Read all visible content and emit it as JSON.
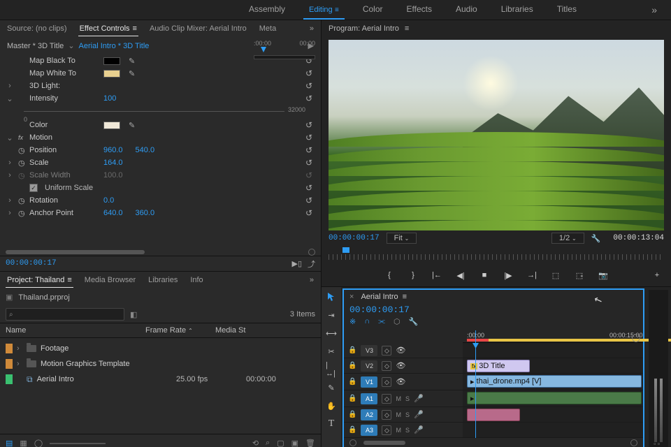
{
  "workspaces": [
    "Assembly",
    "Editing",
    "Color",
    "Effects",
    "Audio",
    "Libraries",
    "Titles"
  ],
  "activeWorkspace": "Editing",
  "source": {
    "tabs": {
      "source": "Source: (no clips)",
      "ec": "Effect Controls",
      "mixer": "Audio Clip Mixer: Aerial Intro",
      "meta": "Meta"
    },
    "master": "Master * 3D Title",
    "clip": "Aerial Intro * 3D Title",
    "rulerZero": ":00:00",
    "rulerOne": "00:00",
    "rows": {
      "mapBlack": "Map Black To",
      "mapWhite": "Map White To",
      "light3d": "3D Light:",
      "intensity": "Intensity",
      "intensityVal": "100",
      "sliderMin": "0",
      "sliderMax": "32000",
      "color": "Color",
      "motion": "Motion",
      "position": "Position",
      "posX": "960.0",
      "posY": "540.0",
      "scale": "Scale",
      "scaleVal": "164.0",
      "scaleWidth": "Scale Width",
      "scaleWidthVal": "100.0",
      "uniform": "Uniform Scale",
      "rotation": "Rotation",
      "rotationVal": "0.0",
      "anchor": "Anchor Point",
      "anchorX": "640.0",
      "anchorY": "360.0"
    },
    "timecode": "00:00:00:17"
  },
  "project": {
    "tabs": {
      "project": "Project: Thailand",
      "browser": "Media Browser",
      "libraries": "Libraries",
      "info": "Info"
    },
    "file": "Thailand.prproj",
    "itemsLabel": "3 Items",
    "columns": {
      "name": "Name",
      "framerate": "Frame Rate",
      "media": "Media St"
    },
    "items": [
      {
        "name": "Footage",
        "type": "folder",
        "color": "#d08a3a"
      },
      {
        "name": "Motion Graphics Template",
        "type": "folder",
        "color": "#d08a3a"
      },
      {
        "name": "Aerial Intro",
        "type": "sequence",
        "color": "#3ac070",
        "framerate": "25.00 fps",
        "media": "00:00:00"
      }
    ]
  },
  "program": {
    "title": "Program: Aerial Intro",
    "tcLeft": "00:00:00:17",
    "fit": "Fit",
    "half": "1/2",
    "tcRight": "00:00:13:04"
  },
  "timeline": {
    "title": "Aerial Intro",
    "timecode": "00:00:00:17",
    "ruler": {
      "t0": ":00:00",
      "t1": "00:00:15:00"
    },
    "tracks": {
      "v3": "V3",
      "v2": "V2",
      "v1": "V1",
      "a1": "A1",
      "a2": "A2",
      "a3": "A3"
    },
    "clips": {
      "title": "3D Title",
      "video": "thai_drone.mp4 [V]"
    },
    "ms": {
      "m": "M",
      "s": "S"
    }
  }
}
